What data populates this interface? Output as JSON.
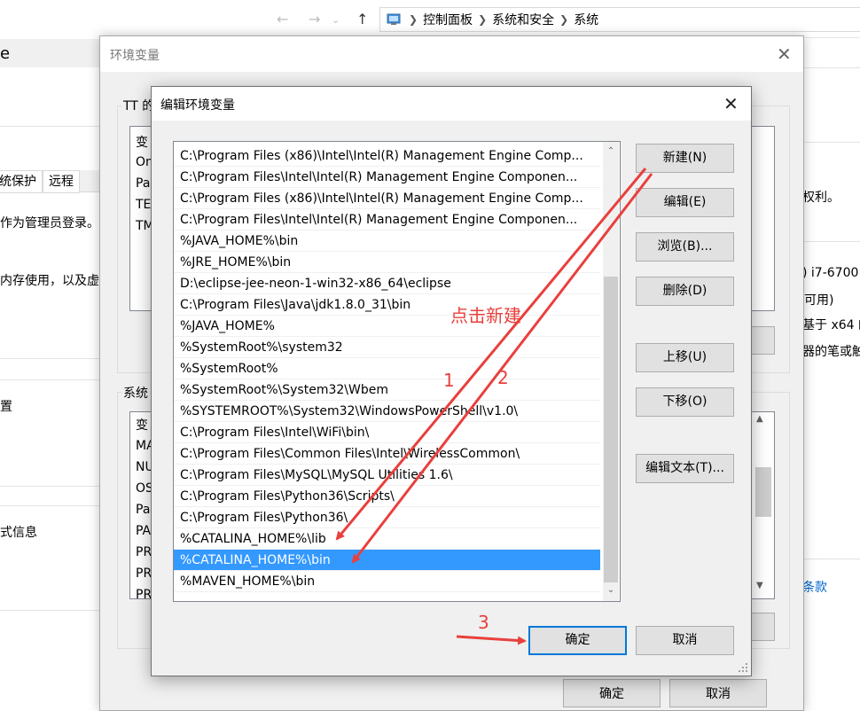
{
  "background": {
    "left_panel": {
      "title_fragment": "e",
      "tabs": [
        "统保护",
        "远程"
      ],
      "texts": [
        "作为管理员登录。",
        "内存使用，以及虚",
        "置",
        "式信息"
      ]
    },
    "explorer": {
      "breadcrumbs": [
        "控制面板",
        "系统和安全",
        "系统"
      ]
    },
    "right_panel": {
      "texts": [
        "权利。",
        ") i7-6700",
        "可用)",
        "基于 x64 的",
        "器的笔或触"
      ],
      "link": "条款"
    }
  },
  "env_dialog": {
    "title": "环境变量",
    "user_group_label": "TT 的",
    "user_rows": [
      "变",
      "On",
      "Pa",
      "TE",
      "TM"
    ],
    "system_group_label": "系统",
    "system_rows": [
      "变",
      "MA",
      "NU",
      "OS",
      "Pa",
      "PA",
      "PR",
      "PR",
      "PR"
    ],
    "ok_label": "确定",
    "cancel_label": "取消"
  },
  "edit_dialog": {
    "title": "编辑环境变量",
    "paths": [
      "C:\\Program Files (x86)\\Intel\\Intel(R) Management Engine Comp...",
      "C:\\Program Files\\Intel\\Intel(R) Management Engine Componen...",
      "C:\\Program Files (x86)\\Intel\\Intel(R) Management Engine Comp...",
      "C:\\Program Files\\Intel\\Intel(R) Management Engine Componen...",
      "%JAVA_HOME%\\bin",
      "%JRE_HOME%\\bin",
      "D:\\eclipse-jee-neon-1-win32-x86_64\\eclipse",
      "C:\\Program Files\\Java\\jdk1.8.0_31\\bin",
      "%JAVA_HOME%",
      "%SystemRoot%\\system32",
      "%SystemRoot%",
      "%SystemRoot%\\System32\\Wbem",
      "%SYSTEMROOT%\\System32\\WindowsPowerShell\\v1.0\\",
      "C:\\Program Files\\Intel\\WiFi\\bin\\",
      "C:\\Program Files\\Common Files\\Intel\\WirelessCommon\\",
      "C:\\Program Files\\MySQL\\MySQL Utilities 1.6\\",
      "C:\\Program Files\\Python36\\Scripts\\",
      "C:\\Program Files\\Python36\\",
      "%CATALINA_HOME%\\lib",
      "%CATALINA_HOME%\\bin",
      "%MAVEN_HOME%\\bin"
    ],
    "selected_index": 19,
    "buttons": {
      "new": "新建(N)",
      "edit": "编辑(E)",
      "browse": "浏览(B)...",
      "delete": "删除(D)",
      "move_up": "上移(U)",
      "move_down": "下移(O)",
      "edit_text": "编辑文本(T)..."
    },
    "ok_label": "确定",
    "cancel_label": "取消"
  },
  "annotations": {
    "click_new": "点击新建",
    "step1": "1",
    "step2": "2",
    "step3": "3",
    "color": "#e8403d"
  }
}
